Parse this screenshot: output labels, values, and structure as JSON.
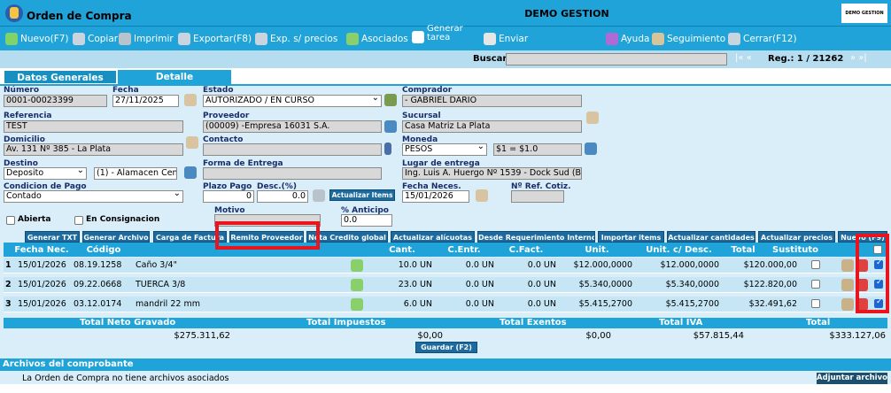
{
  "window": {
    "title": "Orden de Compra",
    "company": "DEMO GESTION",
    "logo_text": "DEMO GESTION"
  },
  "toolbar": {
    "nuevo": "Nuevo(F7)",
    "copiar": "Copiar",
    "imprimir": "Imprimir",
    "exportar": "Exportar(F8)",
    "exp_precios": "Exp. s/ precios",
    "asociados": "Asociados",
    "generar_tarea_1": "Generar",
    "generar_tarea_2": "tarea",
    "enviar": "Enviar",
    "ayuda": "Ayuda",
    "seguimiento": "Seguimiento",
    "cerrar": "Cerrar(F12)"
  },
  "search": {
    "label": "Buscar",
    "value": "",
    "nav_prev": "|«  «",
    "reg": "Reg.: 1 / 21262",
    "nav_next": "»  »|"
  },
  "tabs": [
    "Datos Generales",
    "Detalle"
  ],
  "form": {
    "numero_label": "Número",
    "numero": "0001-00023399",
    "fecha_label": "Fecha",
    "fecha": "27/11/2025",
    "estado_label": "Estado",
    "estado": "AUTORIZADO / EN CURSO",
    "comprador_label": "Comprador",
    "comprador": "- GABRIEL DARIO",
    "referencia_label": "Referencia",
    "referencia": "TEST",
    "proveedor_label": "Proveedor",
    "proveedor": "(00009) -Empresa 16031 S.A.",
    "sucursal_label": "Sucursal",
    "sucursal": "Casa Matriz La Plata",
    "domicilio_label": "Domicilio",
    "domicilio": "Av. 131 Nº 385 - La Plata",
    "contacto_label": "Contacto",
    "contacto": "",
    "moneda_label": "Moneda",
    "moneda": "PESOS",
    "cotizacion": "$1 = $1.0",
    "destino_label": "Destino",
    "destino": "Deposito",
    "almacen": "(1) - Alamacen Cent",
    "forma_entrega_label": "Forma de Entrega",
    "forma_entrega": "",
    "lugar_entrega_label": "Lugar de entrega",
    "lugar_entrega": "Ing. Luis A. Huergo Nº 1539 - Dock Sud (B",
    "condicion_pago_label": "Condicion de Pago",
    "condicion_pago": "Contado",
    "plazo_pago_label": "Plazo Pago",
    "plazo_pago": "0",
    "desc_label": "Desc.(%)",
    "desc": "0.0",
    "actualizar_items": "Actualizar Items",
    "fecha_neces_label": "Fecha Neces.",
    "fecha_neces": "15/01/2026",
    "ref_cotiz_label": "Nº Ref. Cotiz.",
    "ref_cotiz": "",
    "abierta_label": "Abierta",
    "consignacion_label": "En Consignacion",
    "motivo_label": "Motivo",
    "motivo": "",
    "anticipo_label": "% Anticipo",
    "anticipo": "0.0"
  },
  "actions": [
    "Generar TXT",
    "Generar Archivo",
    "Carga de Factura",
    "Remito Proveedor",
    "Nota Credito global",
    "Actualizar alícuotas",
    "Desde Requerimiento Interno",
    "Importar items",
    "Actualizar cantidades",
    "Actualizar precios",
    "Nuevo (F9)"
  ],
  "grid": {
    "headers": [
      "Fecha Nec.",
      "Código",
      "",
      "Cant.",
      "C.Entr.",
      "C.Fact.",
      "Unit.",
      "Unit. c/ Desc.",
      "Total",
      "Sustituto"
    ],
    "rows": [
      {
        "n": "1",
        "fecha": "15/01/2026",
        "codigo": "08.19.1258",
        "desc": "Caño 3/4\"",
        "cant": "10.0 UN",
        "entr": "0.0 UN",
        "fact": "0.0 UN",
        "unit": "$12.000,0000",
        "unit_desc": "$12.000,0000",
        "total": "$120.000,00"
      },
      {
        "n": "2",
        "fecha": "15/01/2026",
        "codigo": "09.22.0668",
        "desc": "TUERCA 3/8",
        "cant": "23.0 UN",
        "entr": "0.0 UN",
        "fact": "0.0 UN",
        "unit": "$5.340,0000",
        "unit_desc": "$5.340,0000",
        "total": "$122.820,00"
      },
      {
        "n": "3",
        "fecha": "15/01/2026",
        "codigo": "03.12.0174",
        "desc": "mandril 22 mm",
        "cant": "6.0 UN",
        "entr": "0.0 UN",
        "fact": "0.0 UN",
        "unit": "$5.415,2700",
        "unit_desc": "$5.415,2700",
        "total": "$32.491,62"
      }
    ]
  },
  "totals": {
    "neto_label": "Total Neto Gravado",
    "neto": "$275.311,62",
    "impuestos_label": "Total Impuestos",
    "impuestos": "$0,00",
    "exentos_label": "Total Exentos",
    "exentos": "$0,00",
    "iva_label": "Total IVA",
    "iva": "$57.815,44",
    "total_label": "Total",
    "total": "$333.127,06"
  },
  "save_button": "Guardar (F2)",
  "archivos": {
    "title": "Archivos del comprobante",
    "message": "La Orden de Compra no tiene archivos asociados",
    "add_button": "Adjuntar archivo"
  }
}
